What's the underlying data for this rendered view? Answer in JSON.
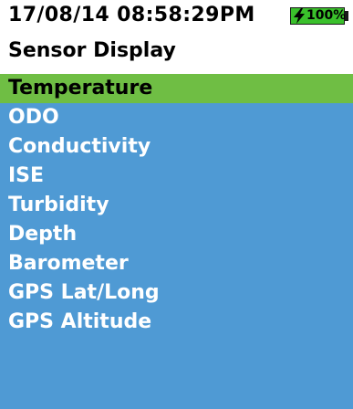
{
  "status_bar": {
    "datetime": "17/08/14  08:58:29PM",
    "battery_percent": "100%",
    "battery_level": 1.0,
    "charging_icon": "lightning-bolt-icon"
  },
  "screen": {
    "title": "Sensor Display"
  },
  "menu": {
    "items": [
      {
        "label": "Temperature",
        "selected": true
      },
      {
        "label": "ODO",
        "selected": false
      },
      {
        "label": "Conductivity",
        "selected": false
      },
      {
        "label": "ISE",
        "selected": false
      },
      {
        "label": "Turbidity",
        "selected": false
      },
      {
        "label": "Depth",
        "selected": false
      },
      {
        "label": "Barometer",
        "selected": false
      },
      {
        "label": "GPS Lat/Long",
        "selected": false
      },
      {
        "label": "GPS Altitude",
        "selected": false
      }
    ]
  },
  "colors": {
    "menu_background": "#4f9ad4",
    "selected_highlight": "#6fbe44",
    "battery_fill": "#3ac02b"
  }
}
